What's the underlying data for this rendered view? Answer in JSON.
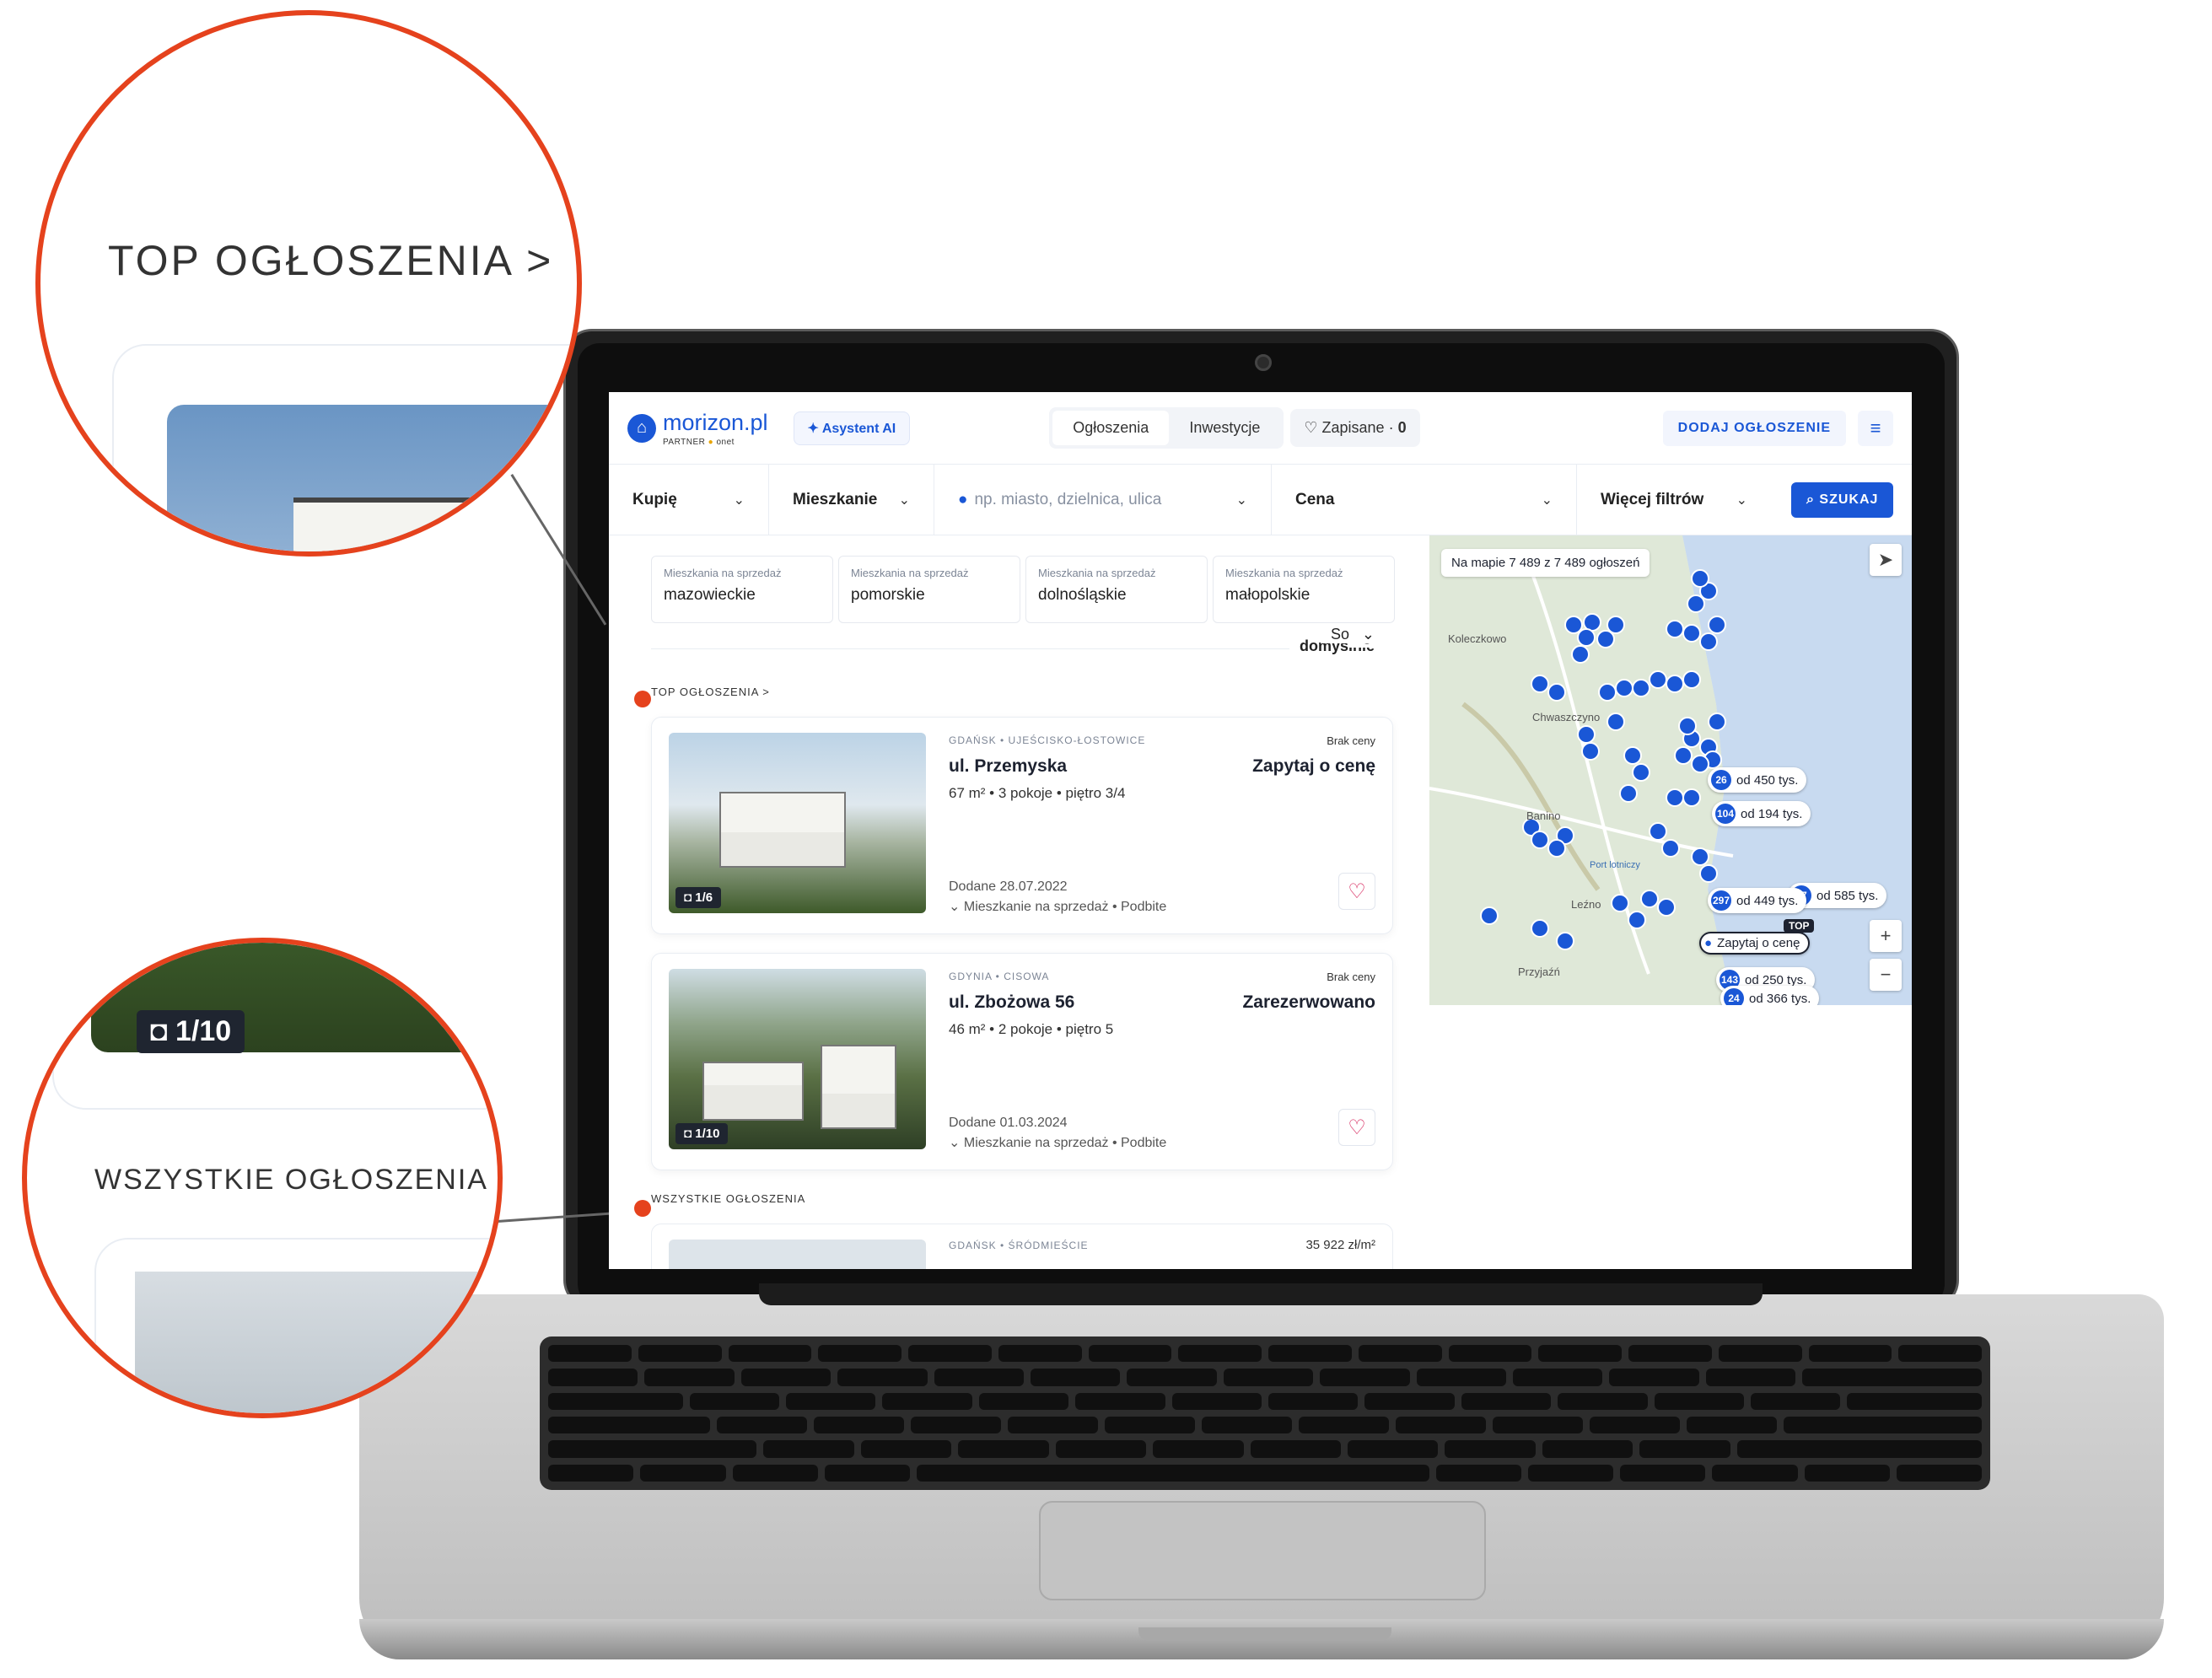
{
  "header": {
    "logo": "morizon.pl",
    "logo_partner": "PARTNER",
    "logo_partner_brand": "onet",
    "ai": "Asystent AI",
    "nav": [
      "Ogłoszenia",
      "Inwestycje"
    ],
    "saved": "Zapisane",
    "saved_count": "0",
    "add": "DODAJ OGŁOSZENIE"
  },
  "search": {
    "deal": "Kupię",
    "type": "Mieszkanie",
    "location_placeholder": "np. miasto, dzielnica, ulica",
    "price": "Cena",
    "more": "Więcej filtrów",
    "button": "SZUKAJ"
  },
  "chips": [
    {
      "sub": "Mieszkania na sprzedaż",
      "value": "mazowieckie"
    },
    {
      "sub": "Mieszkania na sprzedaż",
      "value": "pomorskie"
    },
    {
      "sub": "Mieszkania na sprzedaż",
      "value": "dolnośląskie"
    },
    {
      "sub": "Mieszkania na sprzedaż",
      "value": "małopolskie"
    }
  ],
  "sort": {
    "label": "Sortuj:",
    "value": "domyślnie"
  },
  "sections": {
    "top": "TOP OGŁOSZENIA >",
    "all": "WSZYSTKIE OGŁOSZENIA"
  },
  "listings": [
    {
      "location": "GDAŃSK • UJEŚCISKO-ŁOSTOWICE",
      "title": "ul. Przemyska",
      "meta": "67 m² • 3 pokoje • piętro 3/4",
      "price_label": "Brak ceny",
      "price": "Zapytaj o cenę",
      "date": "Dodane 28.07.2022",
      "type": "Mieszkanie na sprzedaż • Podbite",
      "photos": "1/6"
    },
    {
      "location": "GDYNIA • CISOWA",
      "title": "ul. Zbożowa 56",
      "meta": "46 m² • 2 pokoje • piętro 5",
      "price_label": "Brak ceny",
      "price": "Zarezerwowano",
      "date": "Dodane 01.03.2024",
      "type": "Mieszkanie na sprzedaż • Podbite",
      "photos": "1/10"
    },
    {
      "location": "GDAŃSK • ŚRÓDMIEŚCIE",
      "price": "35 922 zł/m²"
    }
  ],
  "map": {
    "info": "Na mapie 7 489 z 7 489 ogłoszeń",
    "top_label": "TOP",
    "pills": [
      {
        "count": "26",
        "text": "od 450 tys."
      },
      {
        "count": "104",
        "text": "od 194 tys."
      },
      {
        "count": "67",
        "text": "od 585 tys."
      },
      {
        "count": "297",
        "text": "od 449 tys."
      },
      {
        "count": "",
        "text": "Zapytaj o cenę"
      },
      {
        "count": "143",
        "text": "od 250 tys."
      },
      {
        "count": "24",
        "text": "od 366 tys."
      }
    ],
    "places": [
      "Koleczkowo",
      "Chwaszczyno",
      "Banino",
      "Port lotniczy",
      "Leźno",
      "Przyjaźń"
    ]
  },
  "zoom": {
    "top": "TOP OGŁOSZENIA >",
    "photos": "1/10",
    "all": "WSZYSTKIE OGŁOSZENIA"
  },
  "colors": {
    "brand": "#1a57d6",
    "highlight": "#e5421d"
  }
}
